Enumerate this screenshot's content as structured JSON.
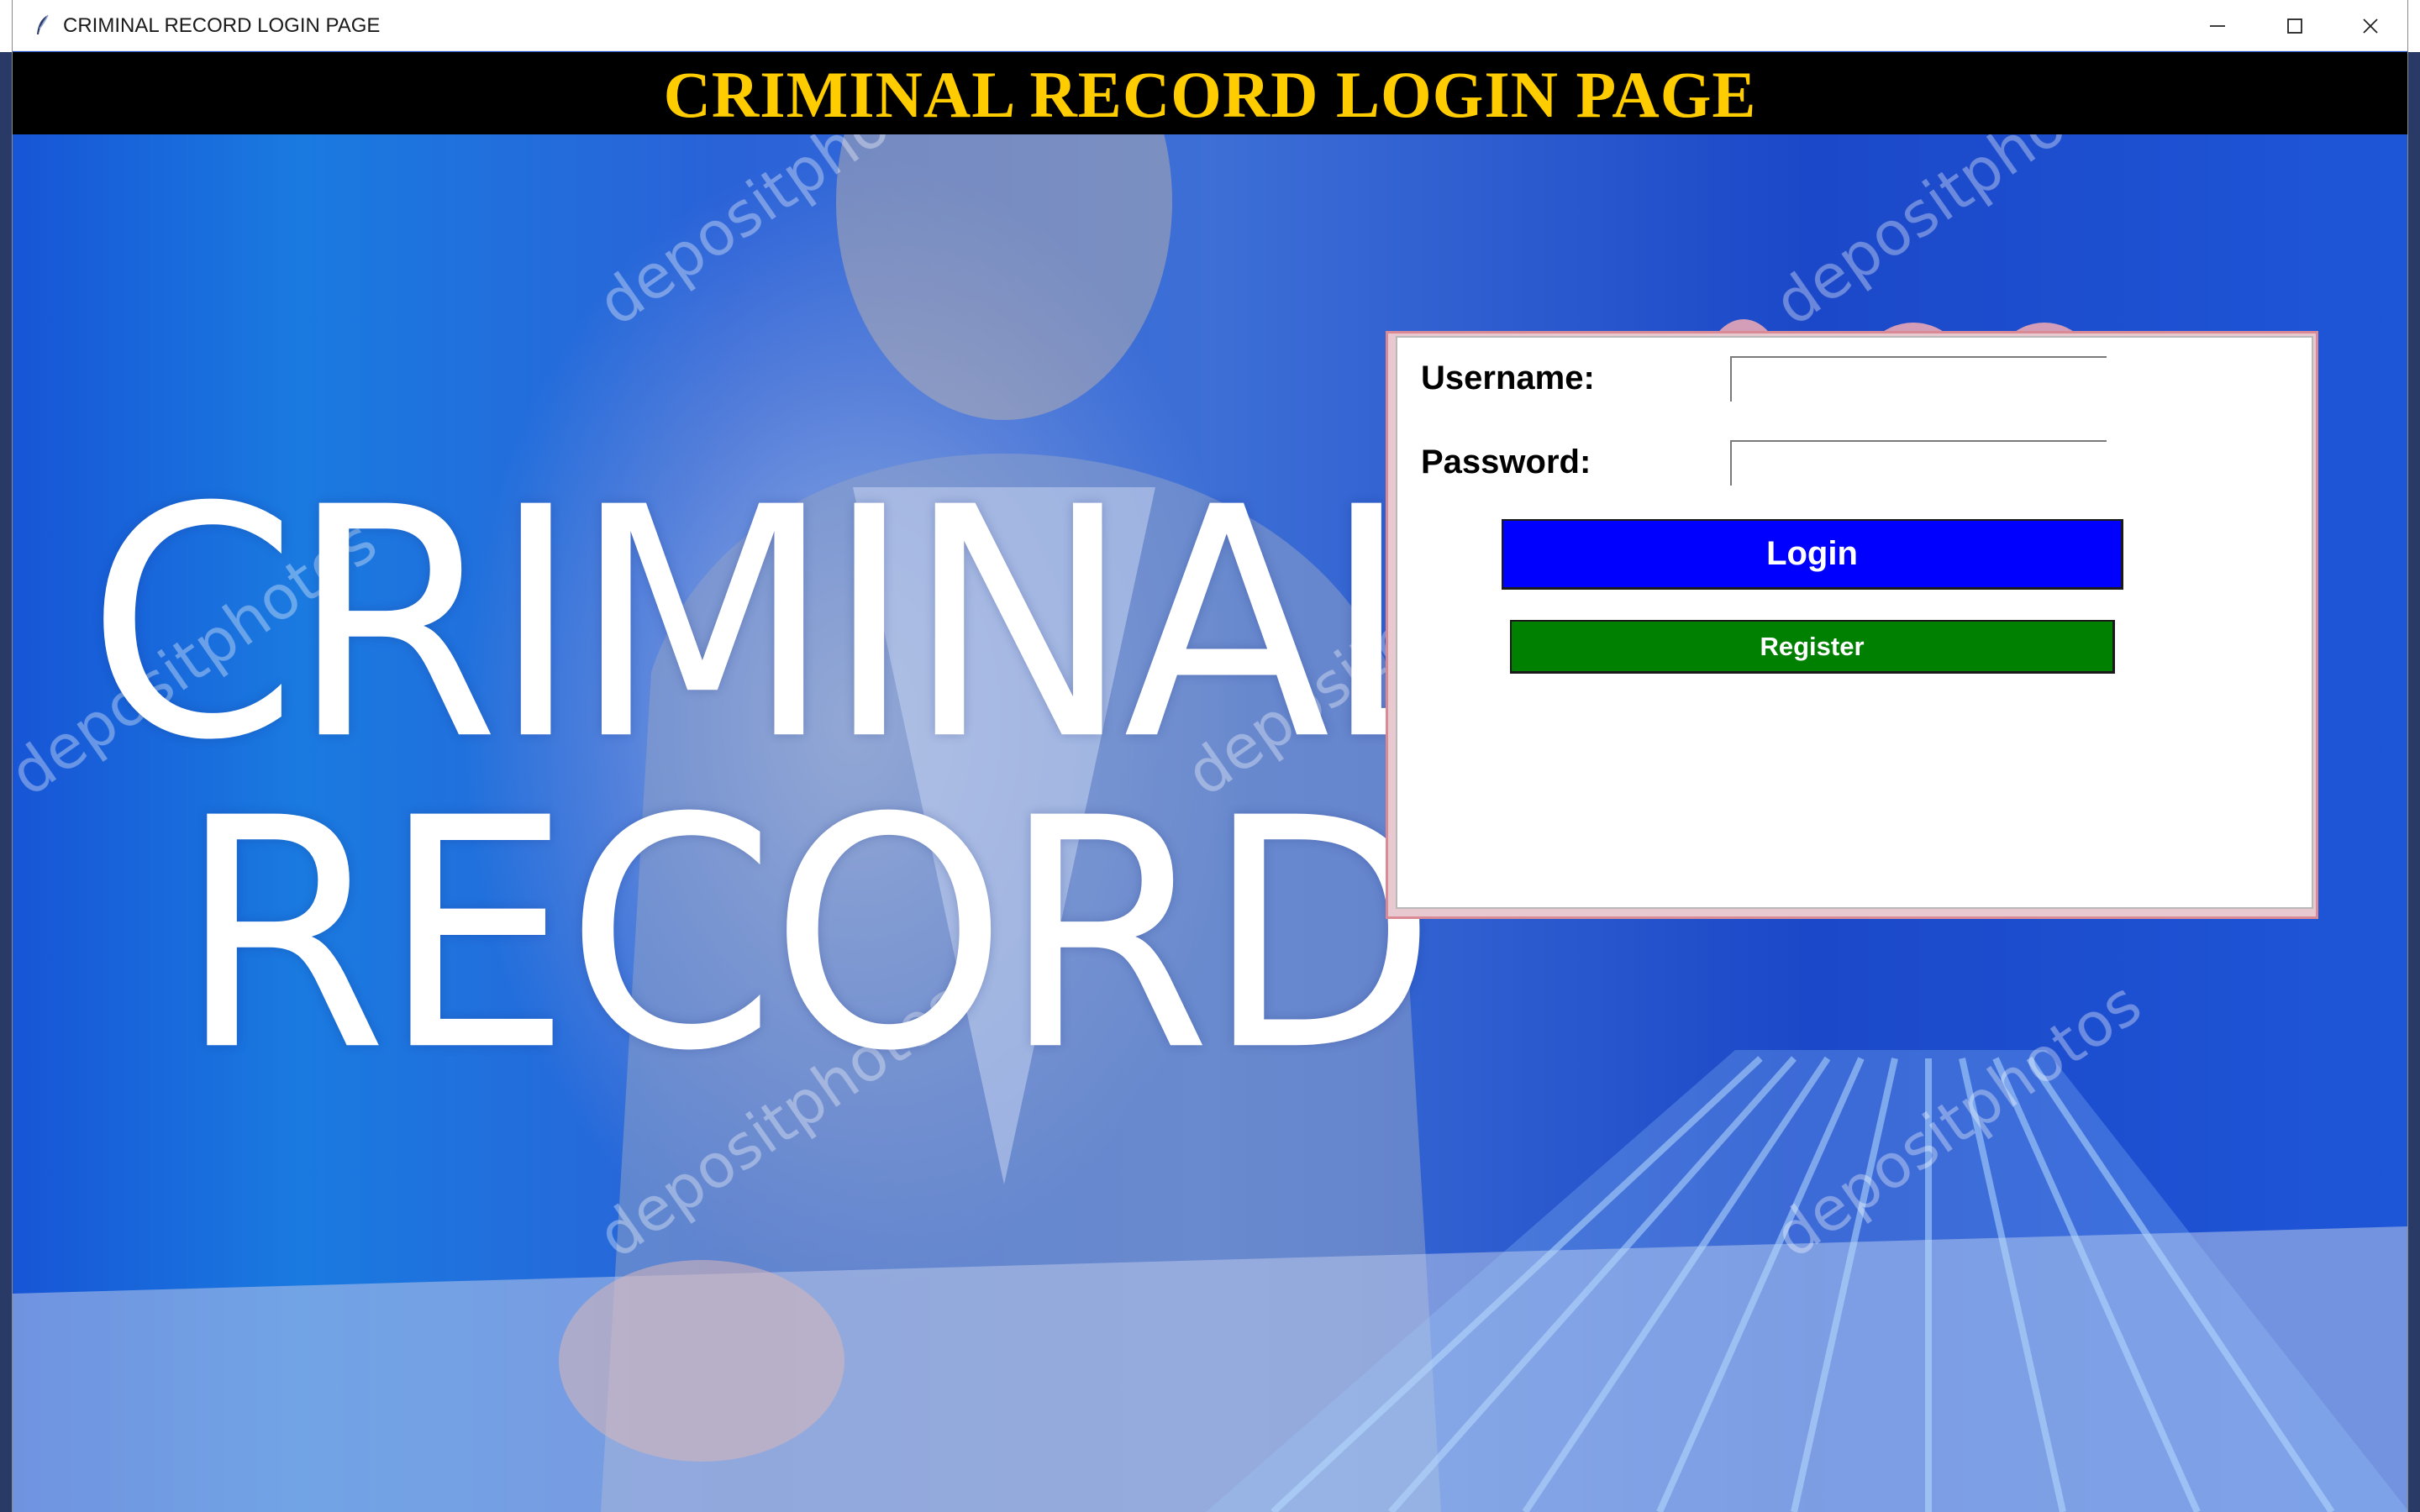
{
  "window": {
    "title": "CRIMINAL RECORD LOGIN PAGE",
    "controls": {
      "minimize": "—",
      "maximize": "☐",
      "close": "✕"
    }
  },
  "header": {
    "title": "CRIMINAL RECORD LOGIN PAGE"
  },
  "hero": {
    "line1": "CRIMINAL",
    "line2": "RECORD",
    "watermark": "depositphotos"
  },
  "login_form": {
    "username_label": "Username:",
    "username_value": "",
    "password_label": "Password:",
    "password_value": "",
    "login_button": "Login",
    "register_button": "Register"
  },
  "colors": {
    "header_bg": "#000000",
    "header_text": "#ffcc00",
    "login_button": "#0000ff",
    "register_button": "#008000",
    "panel_bg": "#ffffff"
  }
}
